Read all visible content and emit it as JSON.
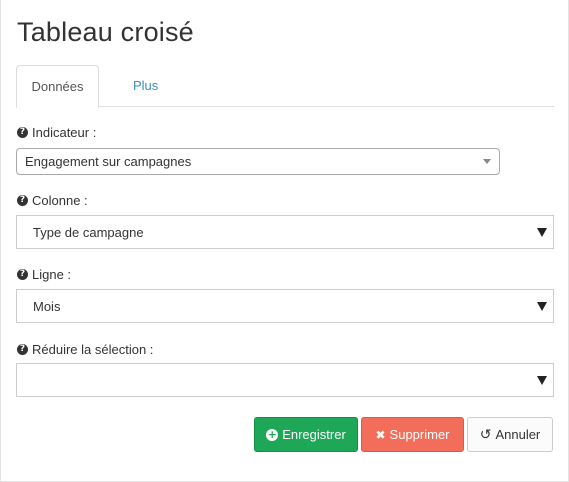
{
  "page": {
    "title": "Tableau croisé"
  },
  "tabs": [
    {
      "label": "Données",
      "active": true
    },
    {
      "label": "Plus",
      "active": false
    }
  ],
  "fields": {
    "indicateur": {
      "label": "Indicateur :",
      "value": "Engagement sur campagnes"
    },
    "colonne": {
      "label": "Colonne :",
      "value": "Type de campagne"
    },
    "ligne": {
      "label": "Ligne :",
      "value": "Mois"
    },
    "reduire": {
      "label": "Réduire la sélection :",
      "value": ""
    }
  },
  "buttons": {
    "save": "Enregistrer",
    "delete": "Supprimer",
    "cancel": "Annuler"
  },
  "icons": {
    "help": "question-circle-icon",
    "save": "plus-circle-icon",
    "delete": "times-icon",
    "cancel": "undo-icon"
  },
  "colors": {
    "save": "#1ea756",
    "delete": "#f26d5a",
    "link": "#3a8fb7"
  }
}
